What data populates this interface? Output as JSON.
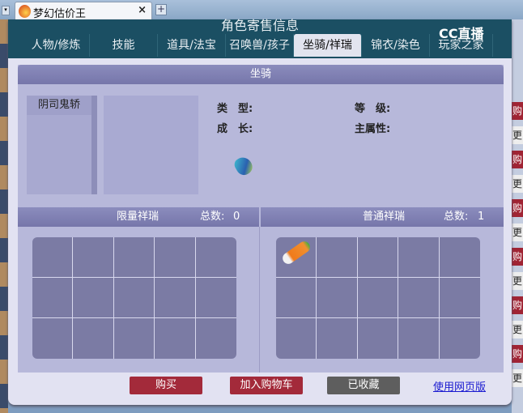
{
  "browser": {
    "tab_title": "梦幻估价王",
    "close": "×",
    "new_tab": "+"
  },
  "dialog": {
    "title": "角色寄售信息",
    "logo": "CC直播",
    "tabs": [
      "人物/修炼",
      "技能",
      "道具/法宝",
      "召唤兽/孩子",
      "坐骑/祥瑞",
      "锦衣/染色",
      "玩家之家"
    ],
    "active_tab": "坐骑/祥瑞",
    "section_title": "坐骑",
    "mounts": [
      "阴司鬼轿"
    ],
    "fields": {
      "type_label": "类　型:",
      "level_label": "等　级:",
      "growth_label": "成　长:",
      "attr_label": "主属性:"
    },
    "limited": {
      "title": "限量祥瑞",
      "count_label": "总数:",
      "count": "0"
    },
    "normal": {
      "title": "普通祥瑞",
      "count_label": "总数:",
      "count": "1"
    },
    "buttons": {
      "buy": "购买",
      "add_cart": "加入购物车",
      "favorited": "已收藏",
      "web_version": "使用网页版"
    }
  },
  "side": {
    "buy_short": "购",
    "more_short": "更"
  }
}
